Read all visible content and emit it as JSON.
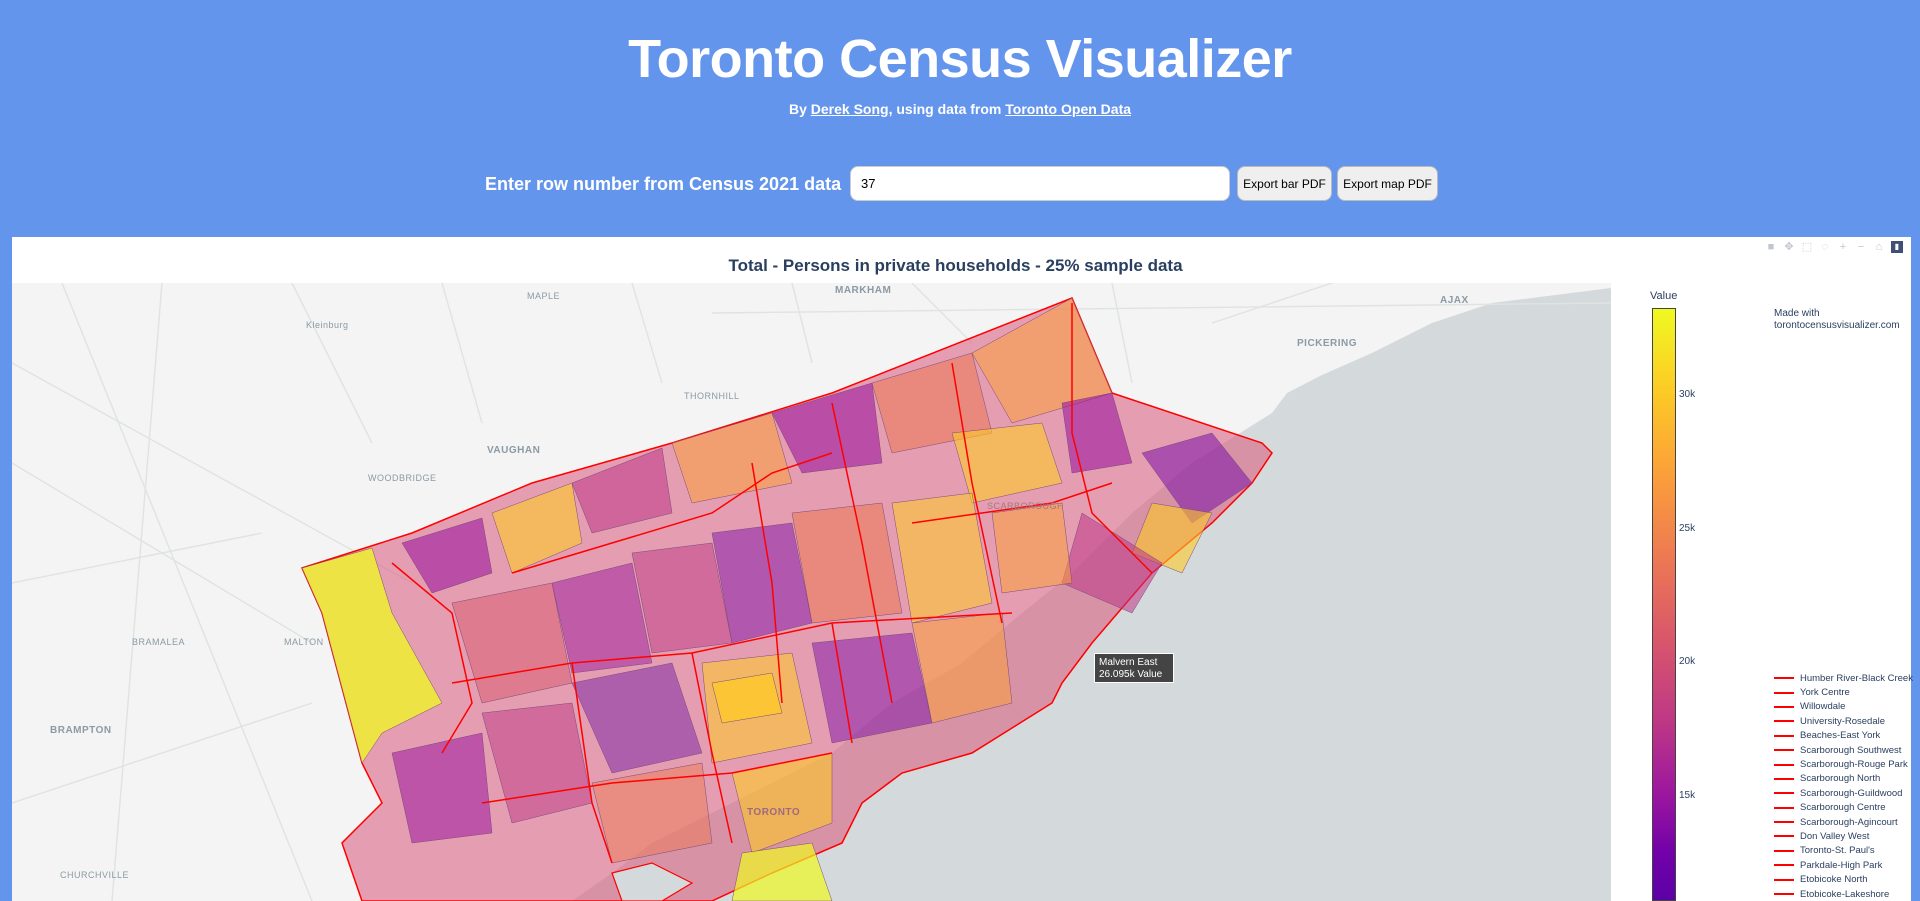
{
  "header": {
    "title": "Toronto Census Visualizer",
    "byline_prefix": "By ",
    "author_link": "Derek Song",
    "byline_middle": ", using data from ",
    "source_link": "Toronto Open Data"
  },
  "controls": {
    "row_label": "Enter row number from Census 2021 data",
    "row_value": "37",
    "export_bar_label": "Export bar PDF",
    "export_map_label": "Export map PDF"
  },
  "plot": {
    "title": "Total - Persons in private households - 25% sample data",
    "tooltip_name": "Malvern East",
    "tooltip_value": "26.095k Value",
    "made_with": "Made with",
    "made_with_site": "torontocensusvisualizer.com",
    "colorbar": {
      "title": "Value",
      "ticks": [
        "30k",
        "25k",
        "20k",
        "15k"
      ],
      "colorscale": [
        "#f0f921",
        "#fdca26",
        "#fb9f3a",
        "#ed7953",
        "#d8576b",
        "#bd3786",
        "#9c179e",
        "#7201a8"
      ]
    },
    "places": {
      "markham": "MARKHAM",
      "ajax": "AJAX",
      "pickering": "PICKERING",
      "vaughan": "VAUGHAN",
      "brampton": "BRAMPTON",
      "toronto": "TORONTO",
      "thornhill": "THORNHILL",
      "kleinburg": "Kleinburg",
      "maple": "MAPLE",
      "woodbridge": "WOODBRIDGE",
      "bramalea": "BRAMALEA",
      "malton": "MALTON",
      "churchville": "CHURCHVILLE",
      "scarborough": "SCARBOROUGH"
    },
    "legend": [
      "Humber River-Black Creek",
      "York Centre",
      "Willowdale",
      "University-Rosedale",
      "Beaches-East York",
      "Scarborough Southwest",
      "Scarborough-Rouge Park",
      "Scarborough North",
      "Scarborough-Guildwood",
      "Scarborough Centre",
      "Scarborough-Agincourt",
      "Don Valley West",
      "Toronto-St. Paul's",
      "Parkdale-High Park",
      "Etobicoke North",
      "Etobicoke-Lakeshore"
    ]
  }
}
